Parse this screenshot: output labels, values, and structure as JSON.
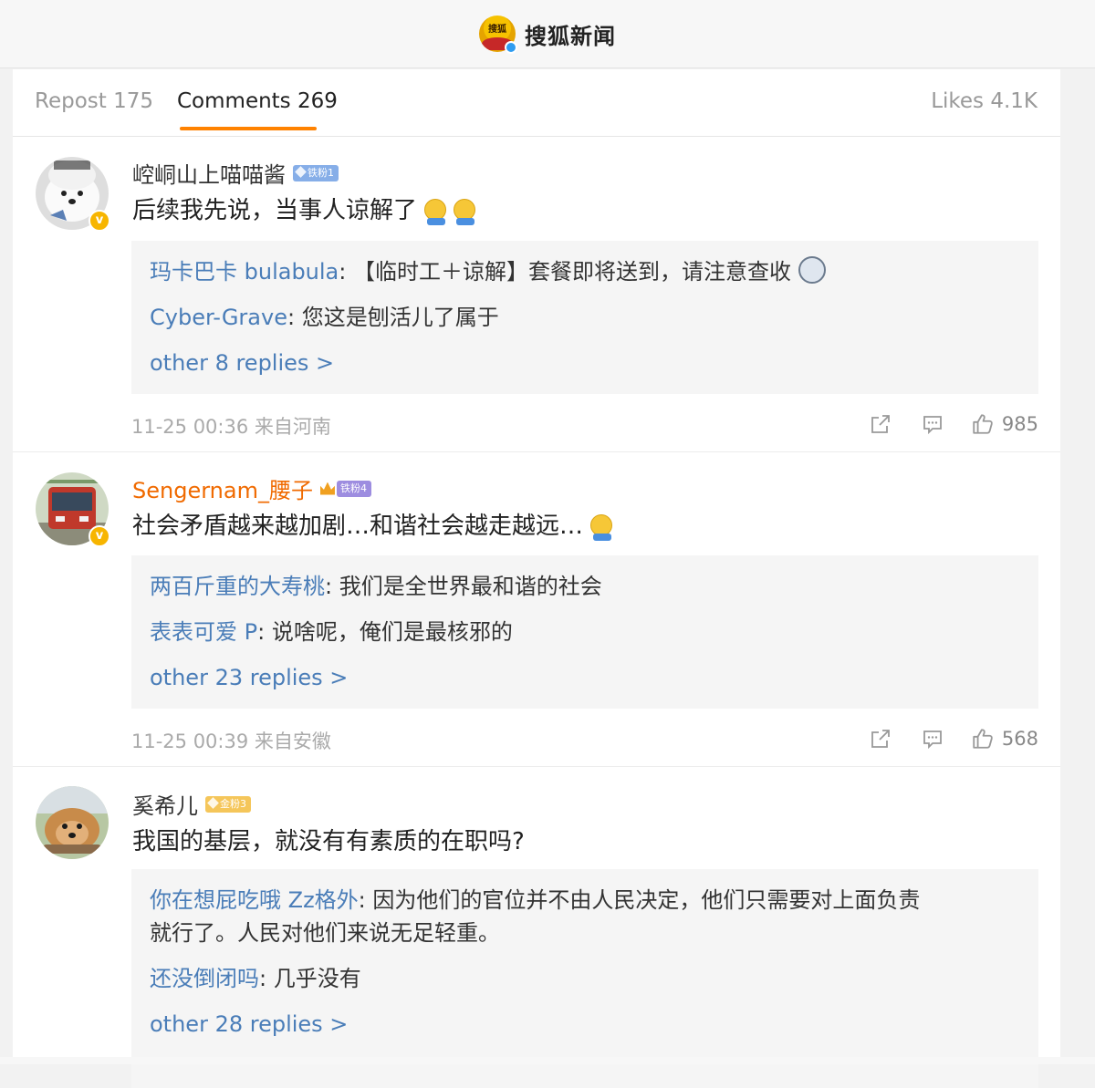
{
  "header": {
    "logo_text": "搜狐",
    "title": "搜狐新闻"
  },
  "tabs": {
    "repost": "Repost 175",
    "comments": "Comments 269",
    "likes": "Likes 4.1K"
  },
  "comments": [
    {
      "username": "崆峒山上喵喵酱",
      "badge": "铁粉1",
      "badge_color": "#86aee8",
      "text": "后续我先说，当事人谅解了",
      "replies": [
        {
          "name": "玛卡巴卡 bulabula",
          "text": ": 【临时工＋谅解】套餐即将送到，请注意查收"
        },
        {
          "name": "Cyber-Grave",
          "text": ": 您这是刨活儿了属于"
        }
      ],
      "more": "other 8 replies >",
      "time": "11-25 00:36 来自河南",
      "likes": "985"
    },
    {
      "username": "Sengernam_腰子",
      "badge": "铁粉4",
      "badge_color": "#9d8de0",
      "text": "社会矛盾越来越加剧…和谐社会越走越远…",
      "replies": [
        {
          "name": "两百斤重的大寿桃",
          "text": ": 我们是全世界最和谐的社会"
        },
        {
          "name": "表表可爱 P",
          "text": ": 说啥呢，俺们是最核邪的"
        }
      ],
      "more": "other 23 replies >",
      "time": "11-25 00:39 来自安徽",
      "likes": "568"
    },
    {
      "username": "奚希儿",
      "badge": "金粉3",
      "badge_color": "#f5c65a",
      "text": "我国的基层，就没有有素质的在职吗?",
      "replies": [
        {
          "name": "你在想屁吃哦 Zz格外",
          "text": ": 因为他们的官位并不由人民决定，他们只需要对上面负责"
        },
        {
          "name": "还没倒闭吗",
          "text": ": 几乎没有"
        }
      ],
      "reply_wrap": "就行了。人民对他们来说无足轻重。",
      "more": "other 28 replies >"
    }
  ],
  "icons": {
    "repost": "repost-icon",
    "comment": "comment-icon",
    "like": "thumbs-up-icon"
  }
}
